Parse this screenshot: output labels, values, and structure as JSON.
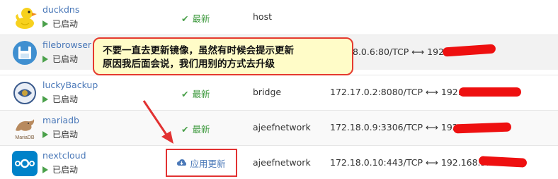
{
  "apps": [
    {
      "icon": "duck-icon",
      "name": "duckdns",
      "status": "已启动",
      "version": "最新",
      "network": "host",
      "port": ""
    },
    {
      "icon": "floppy-disk-icon",
      "name": "filebrowser",
      "status": "已启动",
      "version": "",
      "network": "",
      "port": "8.0.6:80/TCP ⟷ 192."
    },
    {
      "icon": "lucky-backup-icon",
      "name": "luckyBackup",
      "status": "已启动",
      "version": "最新",
      "network": "bridge",
      "port": "172.17.0.2:8080/TCP ⟷ 192."
    },
    {
      "icon": "mariadb-seal-icon",
      "name": "mariadb",
      "status": "已启动",
      "version": "最新",
      "network": "ajeefnetwork",
      "port": "172.18.0.9:3306/TCP ⟷ 192."
    },
    {
      "icon": "nextcloud-icon",
      "name": "nextcloud",
      "status": "已启动",
      "version": "应用更新",
      "network": "ajeefnetwork",
      "port": "172.18.0.10:443/TCP ⟷ 192.168.5.1"
    }
  ],
  "callout": {
    "line1": "不要一直去更新镜像，虽然有时候会提示更新",
    "line2": "原因我后面会说，我们用别的方式去升级"
  },
  "icon_labels": {
    "mariadb": "MariaDB"
  },
  "colors": {
    "link_blue": "#4a78b8",
    "status_green": "#4aa04a",
    "annotation_red": "#e23232",
    "callout_bg": "#fffcc8",
    "nextcloud_blue": "#0082c9"
  }
}
